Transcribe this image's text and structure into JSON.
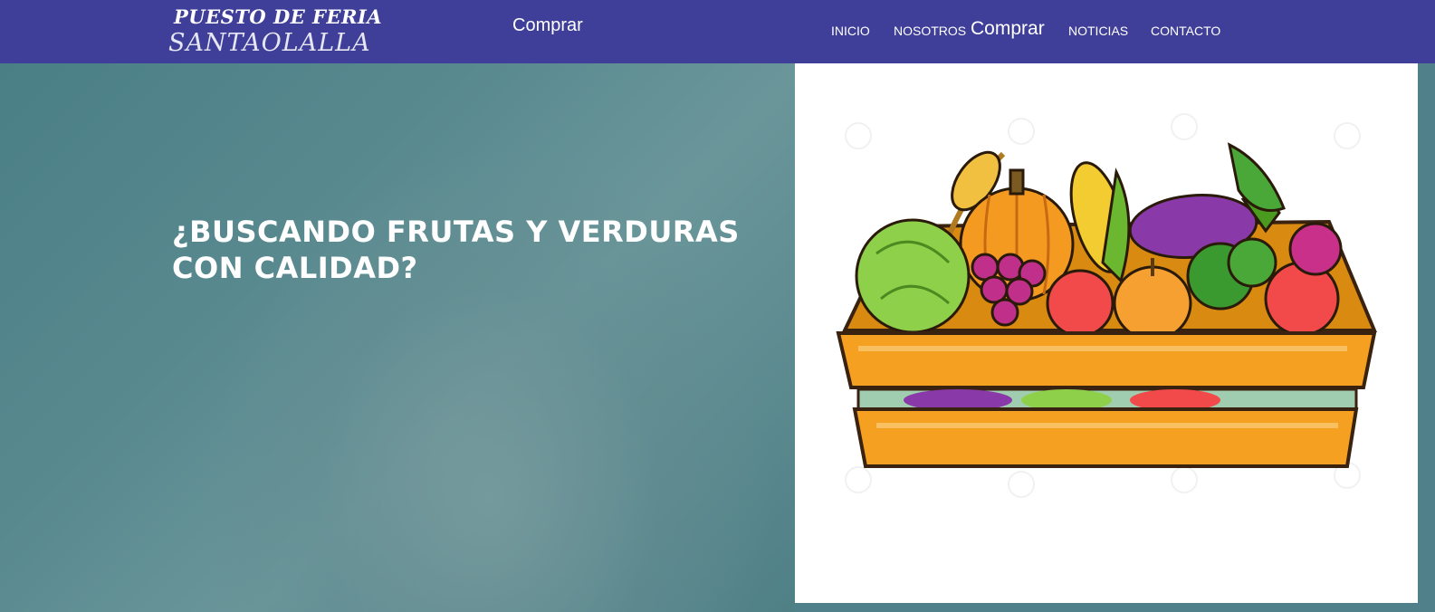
{
  "header": {
    "logo_line1": "PUESTO DE FERIA",
    "logo_line2": "SANTAOLALLA",
    "buy_label": "Comprar",
    "background": "#3f3f9a"
  },
  "nav": {
    "items": [
      {
        "label": "INICIO"
      },
      {
        "label": "NOSOTROS"
      },
      {
        "label": "Comprar"
      },
      {
        "label": "NOTICIAS"
      },
      {
        "label": "CONTACTO"
      }
    ]
  },
  "hero": {
    "title": "¿BUSCANDO FRUTAS Y VERDURAS CON CALIDAD?",
    "image_icon": "vegetable-crate-illustration"
  },
  "colors": {
    "header": "#3f3f9a",
    "hero_teal": "#5a8a90",
    "crate_orange": "#f5a020"
  }
}
